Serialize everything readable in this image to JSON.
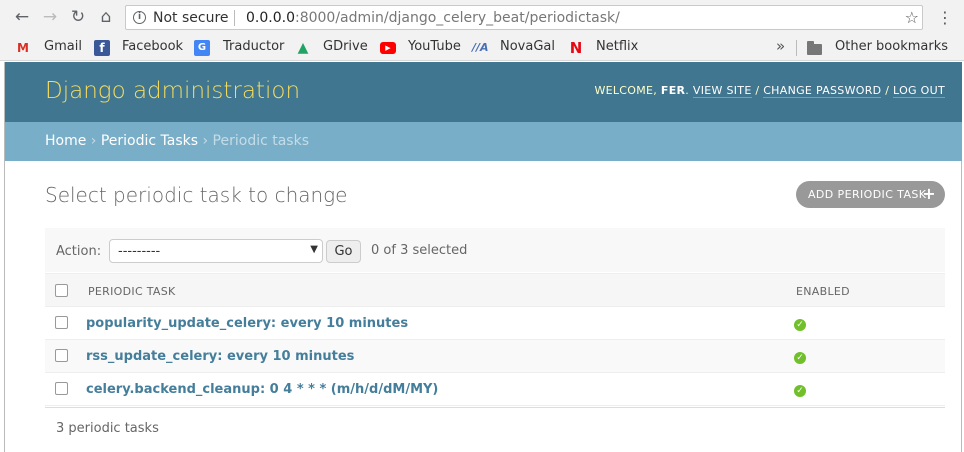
{
  "browser": {
    "security_label": "Not secure",
    "url_host": "0.0.0.0",
    "url_rest": ":8000/admin/django_celery_beat/periodictask/",
    "bookmarks": [
      {
        "label": "Gmail",
        "icon": "gmail-icon",
        "color": "#d93025"
      },
      {
        "label": "Facebook",
        "icon": "facebook-icon",
        "color": "#3b5998"
      },
      {
        "label": "Traductor",
        "icon": "translate-icon",
        "color": "#4285f4"
      },
      {
        "label": "GDrive",
        "icon": "drive-icon",
        "color": "#1fa463"
      },
      {
        "label": "YouTube",
        "icon": "youtube-icon",
        "color": "#ff0000"
      },
      {
        "label": "NovaGal",
        "icon": "novagal-icon",
        "color": "#4a6fb5"
      },
      {
        "label": "Netflix",
        "icon": "netflix-icon",
        "color": "#e50914"
      }
    ],
    "more_label": "»",
    "other_bookmarks": "Other bookmarks"
  },
  "header": {
    "branding": "Django administration",
    "welcome": "WELCOME,",
    "username": "FER",
    "view_site": "VIEW SITE",
    "change_password": "CHANGE PASSWORD",
    "log_out": "LOG OUT"
  },
  "breadcrumbs": [
    "Home",
    "Periodic Tasks",
    "Periodic tasks"
  ],
  "content": {
    "title": "Select periodic task to change",
    "add_button": "ADD PERIODIC TASK"
  },
  "actions": {
    "label": "Action:",
    "selected_option": "---------",
    "go": "Go",
    "counter": "0 of 3 selected"
  },
  "table": {
    "columns": [
      "PERIODIC TASK",
      "ENABLED"
    ],
    "rows": [
      {
        "name": "popularity_update_celery: every 10 minutes",
        "enabled": true
      },
      {
        "name": "rss_update_celery: every 10 minutes",
        "enabled": true
      },
      {
        "name": "celery.backend_cleanup: 0 4 * * * (m/h/d/dM/MY)",
        "enabled": true
      }
    ]
  },
  "paginator": "3 periodic tasks",
  "colors": {
    "header_bg": "#417690",
    "branding": "#f5dd5d",
    "breadcrumbs_bg": "#79aec8",
    "link": "#447e9b",
    "enabled_ok": "#70bf2b"
  }
}
